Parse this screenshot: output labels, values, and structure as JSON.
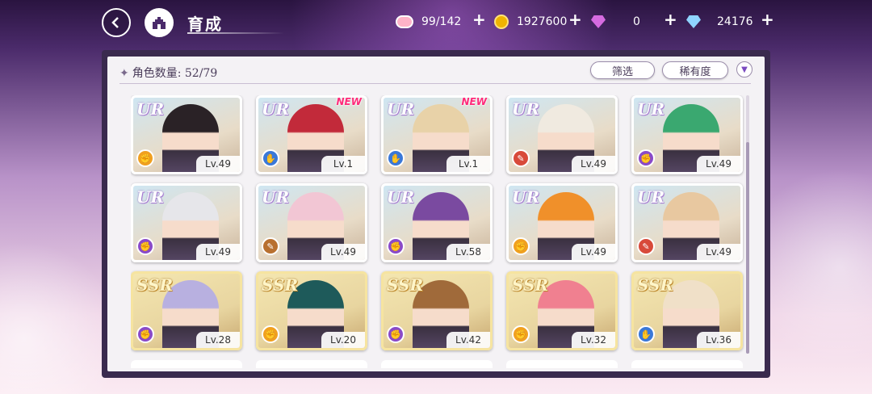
{
  "header": {
    "title": "育成",
    "back_icon": "back-arrow-icon",
    "home_icon": "castle-icon"
  },
  "resources": [
    {
      "name": "stamina",
      "icon": "candy-icon",
      "value": "99/142"
    },
    {
      "name": "coin",
      "icon": "coin-icon",
      "value": "1927600"
    },
    {
      "name": "paid-gem",
      "icon": "pink-gem-icon",
      "value": "0"
    },
    {
      "name": "free-gem",
      "icon": "blue-gem-icon",
      "value": "24176"
    }
  ],
  "toolbar": {
    "count_label": "角色数量: 52/79",
    "filter_label": "筛选",
    "rarity_label": "稀有度"
  },
  "colors": {
    "attr_orange": "#f0a020",
    "attr_blue": "#3a78d8",
    "attr_red": "#d84a3a",
    "attr_purple": "#8a4ac8",
    "attr_brown": "#b87030"
  },
  "cards": [
    {
      "rank": "UR",
      "level": "Lv.49",
      "attr": "orange",
      "new": "",
      "hair": "#2a2226"
    },
    {
      "rank": "UR",
      "level": "Lv.1",
      "attr": "blue",
      "new": "NEW",
      "hair": "#c22a3a"
    },
    {
      "rank": "UR",
      "level": "Lv.1",
      "attr": "blue",
      "new": "NEW",
      "hair": "#e8d2a8"
    },
    {
      "rank": "UR",
      "level": "Lv.49",
      "attr": "red",
      "new": "",
      "hair": "#f0eae0"
    },
    {
      "rank": "UR",
      "level": "Lv.49",
      "attr": "purple",
      "new": "",
      "hair": "#3aa870"
    },
    {
      "rank": "UR",
      "level": "Lv.49",
      "attr": "purple",
      "new": "",
      "hair": "#e6e6ea"
    },
    {
      "rank": "UR",
      "level": "Lv.49",
      "attr": "brown",
      "new": "",
      "hair": "#f2c6d4"
    },
    {
      "rank": "UR",
      "level": "Lv.58",
      "attr": "purple",
      "new": "",
      "hair": "#7a4aa0"
    },
    {
      "rank": "UR",
      "level": "Lv.49",
      "attr": "orange",
      "new": "",
      "hair": "#f0902a"
    },
    {
      "rank": "UR",
      "level": "Lv.49",
      "attr": "red",
      "new": "",
      "hair": "#e8c8a0"
    },
    {
      "rank": "SSR",
      "level": "Lv.28",
      "attr": "purple",
      "new": "",
      "hair": "#b8b0e0"
    },
    {
      "rank": "SSR",
      "level": "Lv.20",
      "attr": "orange",
      "new": "",
      "hair": "#1e5a5a"
    },
    {
      "rank": "SSR",
      "level": "Lv.42",
      "attr": "purple",
      "new": "",
      "hair": "#a06a3a"
    },
    {
      "rank": "SSR",
      "level": "Lv.32",
      "attr": "orange",
      "new": "",
      "hair": "#f08090"
    },
    {
      "rank": "SSR",
      "level": "Lv.36",
      "attr": "blue",
      "new": "",
      "hair": "#f0e0c8"
    }
  ]
}
